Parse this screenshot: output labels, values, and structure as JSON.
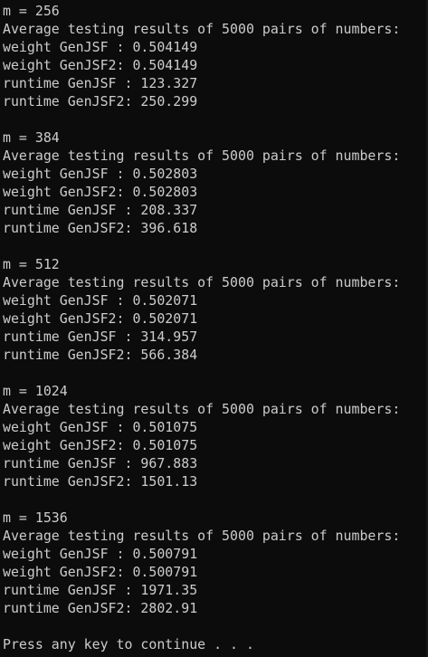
{
  "console": {
    "background": "#0c0c0c",
    "foreground": "#cccccc",
    "header": "Average testing results of 5000 pairs of numbers:",
    "blocks": [
      {
        "m_line": "m = 256",
        "weight_genjsf": "weight GenJSF : 0.504149",
        "weight_genjsf2": "weight GenJSF2: 0.504149",
        "runtime_genjsf": "runtime GenJSF : 123.327",
        "runtime_genjsf2": "runtime GenJSF2: 250.299"
      },
      {
        "m_line": "m = 384",
        "weight_genjsf": "weight GenJSF : 0.502803",
        "weight_genjsf2": "weight GenJSF2: 0.502803",
        "runtime_genjsf": "runtime GenJSF : 208.337",
        "runtime_genjsf2": "runtime GenJSF2: 396.618"
      },
      {
        "m_line": "m = 512",
        "weight_genjsf": "weight GenJSF : 0.502071",
        "weight_genjsf2": "weight GenJSF2: 0.502071",
        "runtime_genjsf": "runtime GenJSF : 314.957",
        "runtime_genjsf2": "runtime GenJSF2: 566.384"
      },
      {
        "m_line": "m = 1024",
        "weight_genjsf": "weight GenJSF : 0.501075",
        "weight_genjsf2": "weight GenJSF2: 0.501075",
        "runtime_genjsf": "runtime GenJSF : 967.883",
        "runtime_genjsf2": "runtime GenJSF2: 1501.13"
      },
      {
        "m_line": "m = 1536",
        "weight_genjsf": "weight GenJSF : 0.500791",
        "weight_genjsf2": "weight GenJSF2: 0.500791",
        "runtime_genjsf": "runtime GenJSF : 1971.35",
        "runtime_genjsf2": "runtime GenJSF2: 2802.91"
      }
    ],
    "prompt": "Press any key to continue . . ."
  }
}
